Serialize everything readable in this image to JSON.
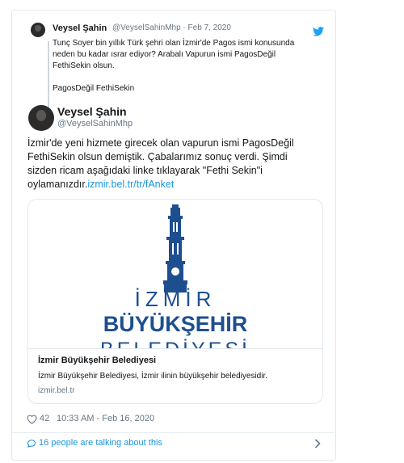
{
  "quoted_tweet": {
    "display_name": "Veysel Şahin",
    "handle_date": "@VeyselSahinMhp · Feb 7, 2020",
    "text_lines": [
      "Tunç Soyer bin yıllık Türk şehri olan İzmir'de Pagos ismi konusunda",
      "neden bu kadar ısrar ediyor? Arabalı Vapurun ismi PagosDeğil",
      "FethiSekin olsun."
    ],
    "hashtags": "PagosDeğil FethiSekin"
  },
  "main_tweet": {
    "display_name": "Veysel Şahin",
    "handle": "@VeyselSahinMhp",
    "text_lines": [
      "İzmir'de yeni hizmete girecek olan vapurun ismi PagosDeğil",
      "FethiSekin olsun demiştik. Çabalarımız sonuç verdi. Şimdi",
      "sizden ricam aşağıdaki linke tıklayarak \"Fethi Sekin\"i"
    ],
    "last_line_prefix": "oylamanızdır.",
    "link_text": "izmir.bel.tr/tr/fAnket"
  },
  "link_card": {
    "logo_line1": "İZMİR",
    "logo_line2": "BÜYÜKŞEHİR",
    "logo_line3": "BELEDİYESİ",
    "title": "İzmir Büyükşehir Belediyesi",
    "description": "İzmir Büyükşehir Belediyesi, İzmir ilinin büyükşehir belediyesidir.",
    "domain": "izmir.bel.tr"
  },
  "footer": {
    "like_count": "42",
    "timestamp": "10:33 AM - Feb 16, 2020"
  },
  "conversation": {
    "label": "16 people are talking about this"
  },
  "colors": {
    "brand_blue": "#1b95e0",
    "logo_blue": "#1d4f8f",
    "text": "#14171a",
    "muted": "#657786"
  },
  "icons": [
    "twitter-bird-icon",
    "heart-icon",
    "speech-bubble-icon",
    "chevron-right-icon"
  ]
}
